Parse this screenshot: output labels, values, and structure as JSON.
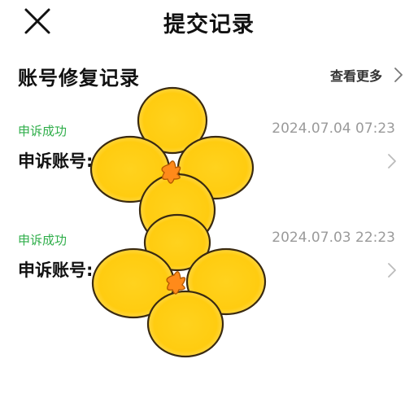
{
  "header": {
    "title": "提交记录",
    "close_icon": "close-icon"
  },
  "section": {
    "title": "账号修复记录",
    "see_more": "查看更多"
  },
  "records": [
    {
      "status": "申诉成功",
      "time": "2024.07.04 07:23",
      "account_label": "申诉账号:"
    },
    {
      "status": "申诉成功",
      "time": "2024.07.03 22:23",
      "account_label": "申诉账号:"
    }
  ],
  "colors": {
    "status_green": "#2fae4a",
    "timestamp_gray": "#9a9a9a",
    "sticker_yellow": "#ffcc1a"
  }
}
